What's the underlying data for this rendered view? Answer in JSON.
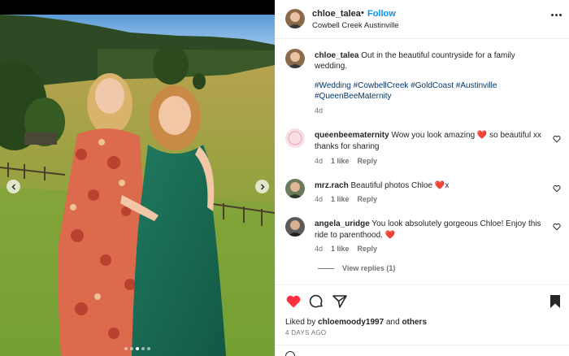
{
  "post": {
    "username": "chloe_talea",
    "follow_label": "Follow",
    "separator": "•",
    "location": "Cowbell Creek Austinville",
    "caption_text": "Out in the beautiful countryside for a family wedding.",
    "hashtags": "#Wedding #CowbellCreek #GoldCoast #Austinville #QueenBeeMaternity",
    "caption_age": "4d"
  },
  "comments": [
    {
      "username": "queenbeematernity",
      "text": "Wow you look amazing ❤️ so beautiful xx thanks for sharing",
      "age": "4d",
      "likes": "1 like",
      "reply": "Reply"
    },
    {
      "username": "mrz.rach",
      "text": "Beautiful photos Chloe ❤️x",
      "age": "4d",
      "likes": "1 like",
      "reply": "Reply"
    },
    {
      "username": "angela_uridge",
      "text": "You look absolutely gorgeous Chloe! Enjoy this ride to parenthood. ❤️",
      "age": "4d",
      "likes": "1 like",
      "reply": "Reply"
    }
  ],
  "view_replies": "View replies (1)",
  "likes": {
    "prefix": "Liked by",
    "user": "chloemoody1997",
    "and": "and",
    "others": "others"
  },
  "date": "4 DAYS AGO",
  "carousel": {
    "count": 5,
    "active_index": 2
  },
  "icons": {
    "like": "heart-filled-icon",
    "comment": "comment-icon",
    "share": "share-icon",
    "save": "bookmark-icon",
    "more": "more-options-icon",
    "emoji": "emoji-icon"
  },
  "colors": {
    "accent": "#0095f6",
    "like": "#ff3040",
    "hashtag": "#00376b",
    "muted": "#737373"
  }
}
